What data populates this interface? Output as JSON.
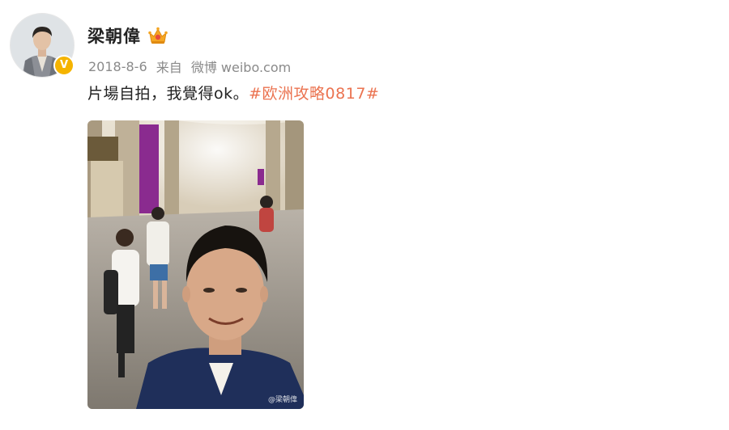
{
  "user": {
    "name": "梁朝偉",
    "vip_icon": "crown-badge-icon",
    "verified_icon": "verified-v-icon",
    "verified_mark": "V"
  },
  "meta": {
    "date": "2018-8-6",
    "from_label": "来自",
    "source": "微博 weibo.com"
  },
  "post": {
    "text": "片場自拍，我覺得ok。",
    "hashtag": "#欧洲攻略0817#"
  },
  "photo": {
    "watermark": "@梁朝偉"
  },
  "colors": {
    "hashtag": "#eb7350",
    "meta": "#8a8a8a",
    "verified": "#f5b400"
  }
}
